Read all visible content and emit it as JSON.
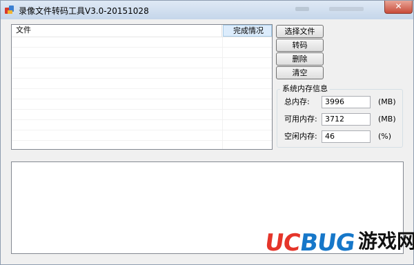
{
  "window": {
    "title": "录像文件转码工具V3.0-20151028",
    "close_label": "✕"
  },
  "file_list": {
    "columns": [
      "文件",
      "完成情况"
    ],
    "rows": []
  },
  "buttons": {
    "select_file": "选择文件",
    "transcode": "转码",
    "delete": "删除",
    "clear": "清空"
  },
  "memory_info": {
    "group_title": "系统内存信息",
    "total_label": "总内存:",
    "total_value": "3996",
    "total_unit": "(MB)",
    "available_label": "可用内存:",
    "available_value": "3712",
    "available_unit": "(MB)",
    "free_label": "空闲内存:",
    "free_value": "46",
    "free_unit": "(%)"
  },
  "log": {
    "text": ""
  },
  "watermark": {
    "uc": "UC",
    "bug": "BUG",
    "cn": "游戏网"
  },
  "colors": {
    "watermark_red": "#e5352a",
    "watermark_blue": "#1677c9",
    "close_button": "#c84c3a",
    "selected_header": "#dcecfc"
  }
}
